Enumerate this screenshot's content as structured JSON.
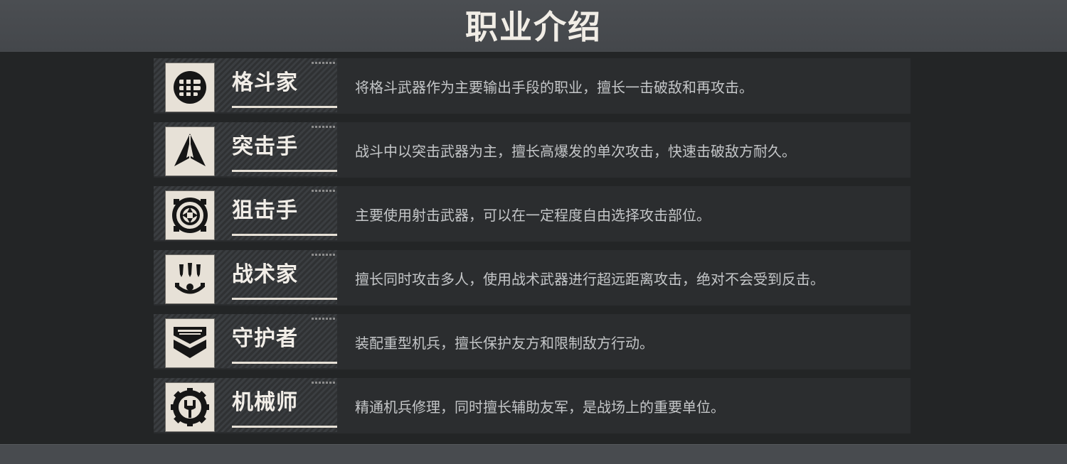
{
  "header": {
    "title": "职业介绍"
  },
  "classes": [
    {
      "name": "格斗家",
      "description": "将格斗武器作为主要输出手段的职业，擅长一击破敌和再攻击。",
      "icon": "fist-icon"
    },
    {
      "name": "突击手",
      "description": "战斗中以突击武器为主，擅长高爆发的单次攻击，快速击破敌方耐久。",
      "icon": "arrowhead-icon"
    },
    {
      "name": "狙击手",
      "description": "主要使用射击武器，可以在一定程度自由选择攻击部位。",
      "icon": "crosshair-icon"
    },
    {
      "name": "战术家",
      "description": "擅长同时攻击多人，使用战术武器进行超远距离攻击，绝对不会受到反击。",
      "icon": "missile-launcher-icon"
    },
    {
      "name": "守护者",
      "description": "装配重型机兵，擅长保护友方和限制敌方行动。",
      "icon": "shield-chevron-icon"
    },
    {
      "name": "机械师",
      "description": "精通机兵修理，同时擅长辅助友军，是战场上的重要单位。",
      "icon": "gear-wrench-icon"
    }
  ]
}
